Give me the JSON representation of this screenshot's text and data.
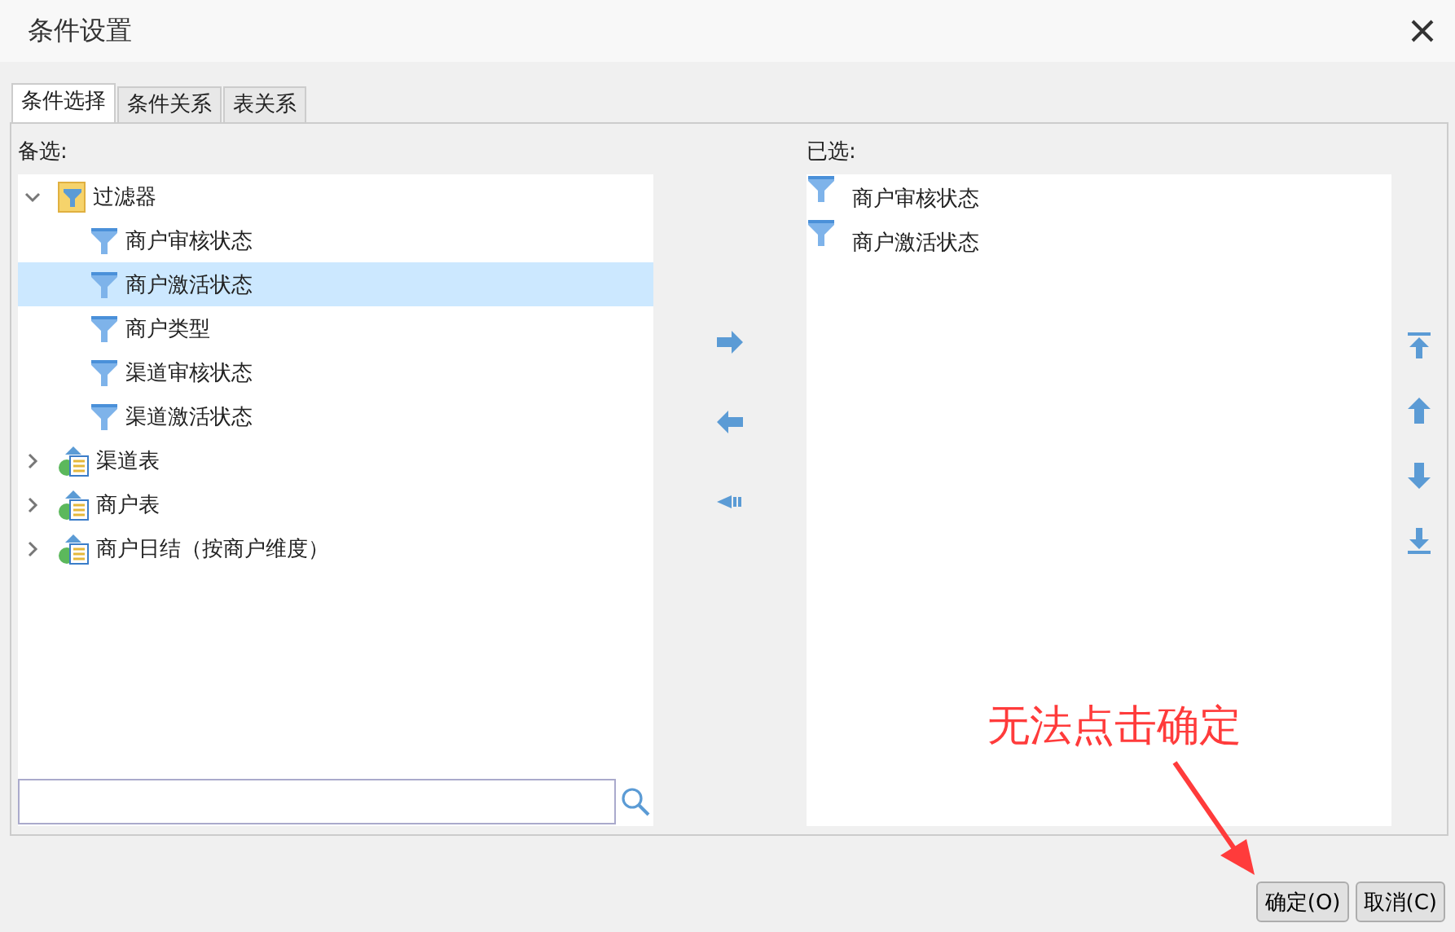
{
  "window": {
    "title": "条件设置"
  },
  "tabs": [
    {
      "label": "条件选择",
      "selected": true
    },
    {
      "label": "条件关系",
      "selected": false
    },
    {
      "label": "表关系",
      "selected": false
    }
  ],
  "available": {
    "label": "备选:",
    "tree": [
      {
        "label": "过滤器",
        "kind": "filter-group",
        "expanded": true,
        "selected": false,
        "children": [
          {
            "label": "商户审核状态",
            "kind": "filter",
            "selected": false
          },
          {
            "label": "商户激活状态",
            "kind": "filter",
            "selected": true
          },
          {
            "label": "商户类型",
            "kind": "filter",
            "selected": false
          },
          {
            "label": "渠道审核状态",
            "kind": "filter",
            "selected": false
          },
          {
            "label": "渠道激活状态",
            "kind": "filter",
            "selected": false
          }
        ]
      },
      {
        "label": "渠道表",
        "kind": "table",
        "expanded": false,
        "selected": false
      },
      {
        "label": "商户表",
        "kind": "table",
        "expanded": false,
        "selected": false
      },
      {
        "label": "商户日结（按商户维度）",
        "kind": "table",
        "expanded": false,
        "selected": false
      }
    ]
  },
  "chosen": {
    "label": "已选:",
    "items": [
      "商户审核状态",
      "商户激活状态"
    ]
  },
  "annotation": {
    "text": "无法点击确定"
  },
  "buttons": [
    "确定(O)",
    "取消(C)"
  ]
}
